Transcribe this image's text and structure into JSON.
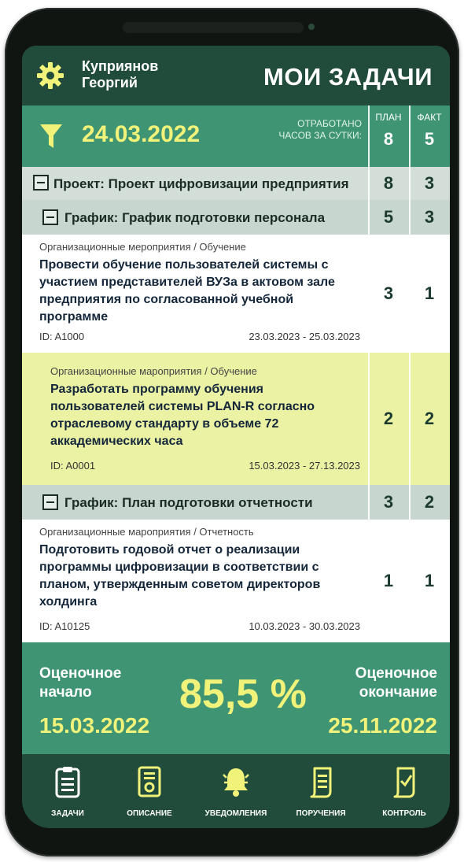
{
  "user": {
    "first_line": "Куприянов",
    "second_line": "Георгий"
  },
  "app_title": "МОИ ЗАДАЧИ",
  "filter": {
    "date": "24.03.2022",
    "worked_label": "ОТРАБОТАНО ЧАСОВ ЗА СУТКИ:"
  },
  "columns": {
    "plan_label": "ПЛАН",
    "fact_label": "ФАКТ",
    "plan_total": "8",
    "fact_total": "5"
  },
  "project": {
    "label": "Проект:",
    "name": "Проект цифровизации предприятия",
    "plan": "8",
    "fact": "3"
  },
  "schedules": [
    {
      "label": "График:",
      "name": "График подготовки персонала",
      "plan": "5",
      "fact": "3"
    },
    {
      "label": "График:",
      "name": "План подготовки отчетности",
      "plan": "3",
      "fact": "2"
    }
  ],
  "tasks": [
    {
      "category": "Организационные мероприятия / Обучение",
      "text": "Провести обучение пользователей системы с участием представителей ВУЗа в актовом зале предприятия по согласованной учебной программе",
      "id": "ID: A1000",
      "range": "23.03.2023 - 25.03.2023",
      "plan": "3",
      "fact": "1"
    },
    {
      "category": "Организационные мароприятия / Обучение",
      "text": "Разработать программу обучения пользователей системы PLAN-R согласно отраслевому стандарту в объеме 72 аккадемических часа",
      "id": "ID: A0001",
      "range": "15.03.2023 - 27.13.2023",
      "plan": "2",
      "fact": "2"
    },
    {
      "category": "Организационные мароприятия / Отчетность",
      "text": "Подготовить годовой отчет о реализации программы цифровизации в соответствии с планом, утвержденным советом директоров холдинга",
      "id": "ID: A10125",
      "range": "10.03.2023 - 30.03.2023",
      "plan": "1",
      "fact": "1"
    }
  ],
  "summary": {
    "start_line1": "Оценочное",
    "start_line2": "начало",
    "start_date": "15.03.2022",
    "end_line1": "Оценочное",
    "end_line2": "окончание",
    "end_date": "25.11.2022",
    "percent": "85,5 %"
  },
  "nav": [
    {
      "label": "ЗАДАЧИ",
      "icon": "clipboard-icon"
    },
    {
      "label": "ОПИСАНИЕ",
      "icon": "document-gear-icon"
    },
    {
      "label": "УВЕДОМЛЕНИЯ",
      "icon": "bell-icon"
    },
    {
      "label": "ПОРУЧЕНИЯ",
      "icon": "scroll-icon"
    },
    {
      "label": "КОНТРОЛЬ",
      "icon": "scroll-check-icon"
    }
  ],
  "colors": {
    "dark_green": "#214c3b",
    "mid_green": "#3e9473",
    "accent_yellow": "#f1f27a",
    "highlight_row": "#ebf2a4"
  }
}
